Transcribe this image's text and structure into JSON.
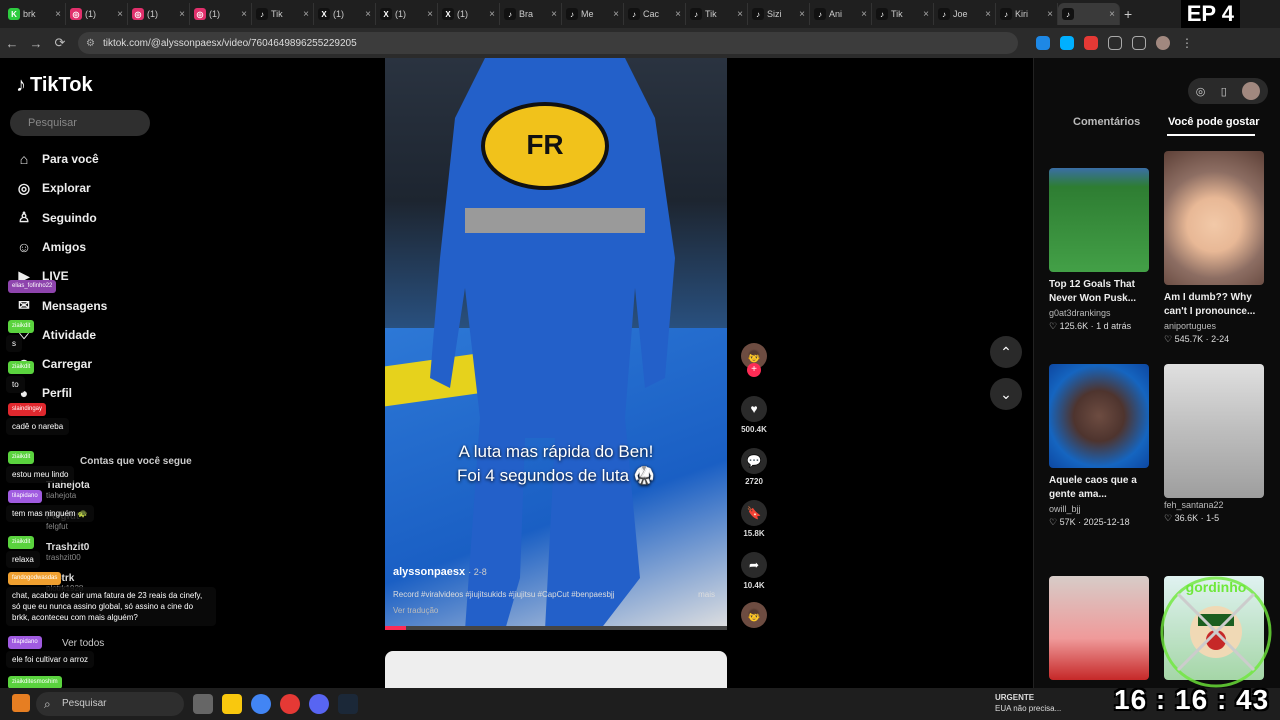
{
  "episode_label": "EP 4",
  "tabs": [
    {
      "title": "brk",
      "color": "#2ecc40",
      "icon_letter": "K"
    },
    {
      "title": "(1)",
      "color": "#e1306c",
      "icon_letter": "◎"
    },
    {
      "title": "(1)",
      "color": "#e1306c",
      "icon_letter": "◎"
    },
    {
      "title": "(1)",
      "color": "#e1306c",
      "icon_letter": "◎"
    },
    {
      "title": "Tik",
      "color": "#111111",
      "icon_letter": "♪"
    },
    {
      "title": "(1)",
      "color": "#111111",
      "icon_letter": "X"
    },
    {
      "title": "(1)",
      "color": "#111111",
      "icon_letter": "X"
    },
    {
      "title": "(1)",
      "color": "#111111",
      "icon_letter": "X"
    },
    {
      "title": "Bra",
      "color": "#111111",
      "icon_letter": "♪"
    },
    {
      "title": "Me",
      "color": "#111111",
      "icon_letter": "♪"
    },
    {
      "title": "Cac",
      "color": "#111111",
      "icon_letter": "♪"
    },
    {
      "title": "Tik",
      "color": "#111111",
      "icon_letter": "♪"
    },
    {
      "title": "Sizi",
      "color": "#111111",
      "icon_letter": "♪"
    },
    {
      "title": "Ani",
      "color": "#111111",
      "icon_letter": "♪"
    },
    {
      "title": "Tik",
      "color": "#111111",
      "icon_letter": "♪"
    },
    {
      "title": "Joe",
      "color": "#111111",
      "icon_letter": "♪"
    },
    {
      "title": "Kiri",
      "color": "#111111",
      "icon_letter": "♪"
    },
    {
      "title": "",
      "color": "#111111",
      "icon_letter": "♪",
      "active": true
    }
  ],
  "address_bar": {
    "url": "tiktok.com/@alyssonpaesx/video/7604649896255229205"
  },
  "sidebar": {
    "logo_text": "TikTok",
    "search_placeholder": "Pesquisar",
    "items": [
      {
        "label": "Para você",
        "icon": "home-icon"
      },
      {
        "label": "Explorar",
        "icon": "compass-icon"
      },
      {
        "label": "Seguindo",
        "icon": "following-icon"
      },
      {
        "label": "Amigos",
        "icon": "friends-icon"
      },
      {
        "label": "LIVE",
        "icon": "live-icon"
      },
      {
        "label": "Mensagens",
        "icon": "messages-icon"
      },
      {
        "label": "Atividade",
        "icon": "activity-icon"
      },
      {
        "label": "Carregar",
        "icon": "upload-icon"
      },
      {
        "label": "Perfil",
        "icon": "profile-icon"
      }
    ],
    "following_header": "Contas que você segue",
    "following": [
      {
        "name": "Tiahejota",
        "handle": "tiahejota"
      },
      {
        "name": "Felgfut",
        "handle": "felgfut"
      },
      {
        "name": "Trashzit0",
        "handle": "trashzit00"
      },
      {
        "name": "Plotrk",
        "handle": "plotrk1928"
      }
    ],
    "see_all": "Ver todos"
  },
  "chat": [
    {
      "user": "elias_fofinho22",
      "color": "#8e44ad",
      "message": ""
    },
    {
      "user": "ziaikdit",
      "color": "#5ad33e",
      "message": "s"
    },
    {
      "user": "ziaikdit",
      "color": "#5ad33e",
      "message": "to"
    },
    {
      "user": "slaindingay",
      "color": "#e0282e",
      "message": "cadê o nareba"
    },
    {
      "user": "ziaikdit",
      "color": "#5ad33e",
      "message": "estou meu lindo"
    },
    {
      "user": "tilapidano",
      "color": "#a05be0",
      "message": "tem mas ninguém 🐢"
    },
    {
      "user": "ziaikdit",
      "color": "#5ad33e",
      "message": "relaxa"
    },
    {
      "user": "fandogodwasdas",
      "color": "#f0a030",
      "message": "chat, acabou de cair uma fatura de 23 reais da cinefy, só que eu nunca assino global, só assino a cine do brkk, aconteceu com mais alguém?"
    },
    {
      "user": "tilapidano",
      "color": "#a05be0",
      "message": "ele foi cultivar o arroz"
    },
    {
      "user": "ziaikditesmoshim",
      "color": "#5ad33e",
      "message": ""
    }
  ],
  "video": {
    "caption_line1": "A luta mas rápida do Ben!",
    "caption_line2": "Foi 4 segundos de luta 🥋",
    "author": "alyssonpaesx",
    "date": "· 2-8",
    "description": "Record #viralvideos #jiujitsukids #jiujitsu #CapCut #benpaesbjj",
    "more": "mais",
    "translate": "Ver tradução",
    "progress": 0.06,
    "patch_text": "FR"
  },
  "actions": {
    "likes": "500.4K",
    "comments": "2720",
    "saves": "15.8K",
    "shares": "10.4K"
  },
  "right_panel": {
    "tab_comments": "Comentários",
    "tab_like": "Você pode gostar",
    "cards": [
      {
        "title": "Top 12 Goals That Never Won Pusk...",
        "author": "g0at3drankings",
        "likes": "125.6K",
        "date": "1 d atrás",
        "thumb": "soccer"
      },
      {
        "title": "Am I dumb?? Why can't I pronounce...",
        "author": "aniportugues",
        "likes": "545.7K",
        "date": "2-24",
        "thumb": "face-light"
      },
      {
        "title": "Aquele caos que a gente ama...",
        "author": "owill_bjj",
        "likes": "57K",
        "date": "2025-12-18",
        "thumb": "face-dark"
      },
      {
        "title": "",
        "author": "feh_santana22",
        "likes": "36.6K",
        "date": "1-5",
        "thumb": "street"
      },
      {
        "title": "",
        "author": "",
        "likes": "",
        "date": "",
        "thumb": "bottom1"
      },
      {
        "title": "",
        "author": "",
        "likes": "",
        "date": "",
        "thumb": "bottom2"
      }
    ]
  },
  "taskbar": {
    "search_label": "Pesquisar",
    "news_title": "URGENTE",
    "news_sub": "EUA não precisa..."
  },
  "clock": "16 : 16 : 43",
  "watermark_text": "gordinho"
}
